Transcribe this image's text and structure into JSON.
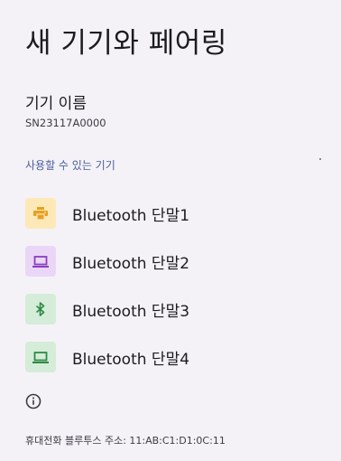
{
  "header": {
    "title": "새 기기와 페어링"
  },
  "device_name": {
    "label": "기기 이름",
    "value": "SN23117A0000"
  },
  "available": {
    "header": "사용할 수 있는 기기"
  },
  "devices": [
    {
      "label": "Bluetooth 단말1",
      "icon": "printer-icon",
      "bg": "#fde8b8",
      "fg": "#e8a020"
    },
    {
      "label": "Bluetooth 단말2",
      "icon": "laptop-icon",
      "bg": "#ead7f7",
      "fg": "#8a3fc0"
    },
    {
      "label": "Bluetooth 단말3",
      "icon": "bluetooth-icon",
      "bg": "#d5ecd9",
      "fg": "#2f8a45"
    },
    {
      "label": "Bluetooth 단말4",
      "icon": "laptop-icon",
      "bg": "#d5ecd9",
      "fg": "#2f8a45"
    }
  ],
  "footer": {
    "text": "휴대전화 블루투스 주소: 11:AB:C1:D1:0C:11"
  }
}
